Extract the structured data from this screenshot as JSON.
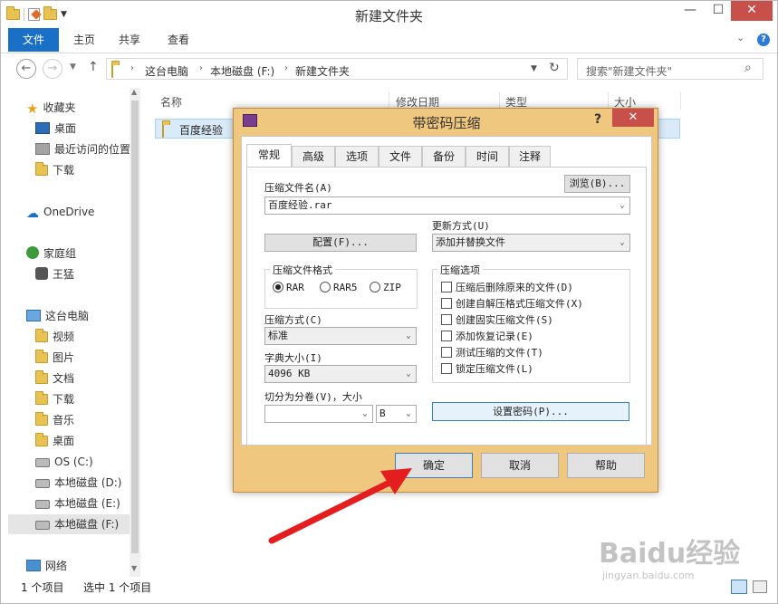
{
  "window": {
    "title": "新建文件夹",
    "controls": {
      "minimize": "—",
      "maximize": "☐",
      "close": "✕"
    }
  },
  "ribbon": {
    "tabs": [
      "文件",
      "主页",
      "共享",
      "查看"
    ]
  },
  "address": {
    "breadcrumbs": [
      "这台电脑",
      "本地磁盘 (F:)",
      "新建文件夹"
    ],
    "search_placeholder": "搜索\"新建文件夹\""
  },
  "sidebar": {
    "items": [
      {
        "label": "收藏夹",
        "icon": "star-icon"
      },
      {
        "label": "桌面",
        "icon": "desktop-icon"
      },
      {
        "label": "最近访问的位置",
        "icon": "recent-icon"
      },
      {
        "label": "下载",
        "icon": "download-folder-icon"
      },
      {
        "label": "OneDrive",
        "icon": "cloud-icon"
      },
      {
        "label": "家庭组",
        "icon": "homegroup-icon"
      },
      {
        "label": "王猛",
        "icon": "user-icon"
      },
      {
        "label": "这台电脑",
        "icon": "computer-icon"
      },
      {
        "label": "视频",
        "icon": "folder-icon"
      },
      {
        "label": "图片",
        "icon": "folder-icon"
      },
      {
        "label": "文档",
        "icon": "folder-icon"
      },
      {
        "label": "下载",
        "icon": "folder-icon"
      },
      {
        "label": "音乐",
        "icon": "folder-icon"
      },
      {
        "label": "桌面",
        "icon": "folder-icon"
      },
      {
        "label": "OS (C:)",
        "icon": "drive-icon"
      },
      {
        "label": "本地磁盘 (D:)",
        "icon": "drive-icon"
      },
      {
        "label": "本地磁盘 (E:)",
        "icon": "drive-icon"
      },
      {
        "label": "本地磁盘 (F:)",
        "icon": "drive-icon"
      },
      {
        "label": "网络",
        "icon": "network-icon"
      }
    ]
  },
  "filelist": {
    "columns": [
      "名称",
      "修改日期",
      "类型",
      "大小"
    ],
    "rows": [
      {
        "name": "百度经验"
      }
    ]
  },
  "status": {
    "count": "1 个项目",
    "selected": "选中 1 个项目"
  },
  "dialog": {
    "title": "带密码压缩",
    "help": "?",
    "close": "✕",
    "tabs": [
      "常规",
      "高级",
      "选项",
      "文件",
      "备份",
      "时间",
      "注释"
    ],
    "archive_name_label": "压缩文件名(A)",
    "browse_button": "浏览(B)...",
    "archive_name_value": "百度经验.rar",
    "update_mode_label": "更新方式(U)",
    "update_mode_value": "添加并替换文件",
    "profile_button": "配置(F)...",
    "format_group": "压缩文件格式",
    "formats": [
      "RAR",
      "RAR5",
      "ZIP"
    ],
    "selected_format": "RAR",
    "method_label": "压缩方式(C)",
    "method_value": "标准",
    "dict_label": "字典大小(I)",
    "dict_value": "4096 KB",
    "split_label": "切分为分卷(V)，大小",
    "split_unit": "B",
    "options_group": "压缩选项",
    "options": [
      "压缩后删除原来的文件(D)",
      "创建自解压格式压缩文件(X)",
      "创建固实压缩文件(S)",
      "添加恢复记录(E)",
      "测试压缩的文件(T)",
      "锁定压缩文件(L)"
    ],
    "password_button": "设置密码(P)...",
    "ok_button": "确定",
    "cancel_button": "取消",
    "help_button": "帮助"
  },
  "watermark": {
    "brand": "Baidu经验",
    "url": "jingyan.baidu.com"
  }
}
